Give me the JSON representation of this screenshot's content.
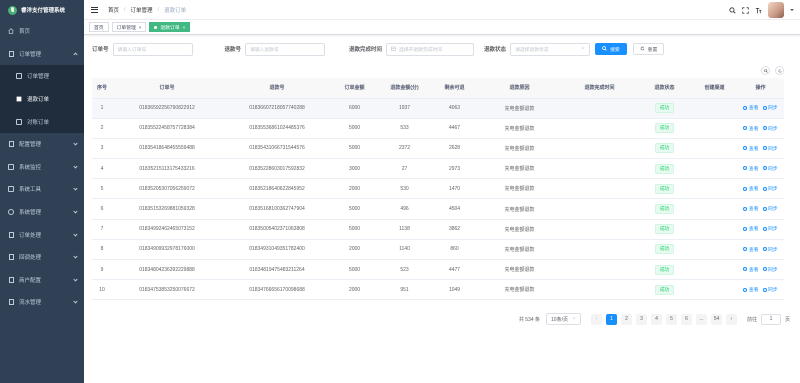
{
  "app": {
    "title": "睿洋支付管理系统"
  },
  "sidebar": {
    "items": [
      {
        "label": "首页",
        "icon": "home-icon"
      },
      {
        "label": "订单管理",
        "icon": "order-icon",
        "expanded": true,
        "children": [
          {
            "label": "订单管理",
            "active": false
          },
          {
            "label": "退款订单",
            "active": true
          },
          {
            "label": "对账订单",
            "active": false
          }
        ]
      },
      {
        "label": "配置管理",
        "icon": "config-icon"
      },
      {
        "label": "系统监控",
        "icon": "monitor-icon"
      },
      {
        "label": "系统工具",
        "icon": "tools-icon"
      },
      {
        "label": "系统管理",
        "icon": "settings-icon"
      },
      {
        "label": "订单处理",
        "icon": "process-icon"
      },
      {
        "label": "回调处理",
        "icon": "callback-icon"
      },
      {
        "label": "商户配置",
        "icon": "merchant-icon"
      },
      {
        "label": "流水管理",
        "icon": "flow-icon"
      }
    ]
  },
  "header": {
    "breadcrumb": [
      "首页",
      "订单管理",
      "退款订单"
    ]
  },
  "tags": [
    {
      "label": "首页",
      "active": false
    },
    {
      "label": "订单管理",
      "active": false
    },
    {
      "label": "退款订单",
      "active": true
    }
  ],
  "filters": {
    "order_no": {
      "label": "订单号",
      "placeholder": "请输入订单号"
    },
    "refund_no": {
      "label": "退款号",
      "placeholder": "请输入退款号"
    },
    "refund_time": {
      "label": "退款完成时间",
      "placeholder": "选择开退款完成时间"
    },
    "refund_status": {
      "label": "退款状态",
      "placeholder": "请选择退款状态"
    },
    "search_label": "搜索",
    "reset_label": "重置"
  },
  "table": {
    "columns": [
      "序号",
      "订单号",
      "退款号",
      "订单金额",
      "退款金额(分)",
      "剩余可退",
      "退款原因",
      "退款完成时间",
      "退款状态",
      "创建渠道",
      "操作"
    ],
    "view_label": "查看",
    "sync_label": "同步",
    "rows": [
      {
        "idx": "1",
        "order_no": "01836592256790822912",
        "refund_no": "01836607218057740288",
        "amount": "6000",
        "refund": "1937",
        "remain": "4063",
        "reason": "充电金额退款",
        "time": "",
        "status": "成功",
        "channel": ""
      },
      {
        "idx": "2",
        "order_no": "01835522458757728384",
        "refund_no": "01835536861024485376",
        "amount": "5000",
        "refund": "533",
        "remain": "4467",
        "reason": "充电金额退款",
        "time": "",
        "status": "成功",
        "channel": ""
      },
      {
        "idx": "3",
        "order_no": "01835418648455559488",
        "refund_no": "01835431066731544576",
        "amount": "5000",
        "refund": "2372",
        "remain": "2628",
        "reason": "充电金额退款",
        "time": "",
        "status": "成功",
        "channel": ""
      },
      {
        "idx": "4",
        "order_no": "01835215113175433216",
        "refund_no": "01835228603017592832",
        "amount": "3000",
        "refund": "27",
        "remain": "2973",
        "reason": "充电金额退款",
        "time": "",
        "status": "成功",
        "channel": ""
      },
      {
        "idx": "5",
        "order_no": "01835205307056259072",
        "refund_no": "01835218640622845952",
        "amount": "2000",
        "refund": "530",
        "remain": "1470",
        "reason": "充电金额退款",
        "time": "",
        "status": "成功",
        "channel": ""
      },
      {
        "idx": "6",
        "order_no": "01835153269881059328",
        "refund_no": "01835168100362747904",
        "amount": "5000",
        "refund": "496",
        "remain": "4504",
        "reason": "充电金额退款",
        "time": "",
        "status": "成功",
        "channel": ""
      },
      {
        "idx": "7",
        "order_no": "01834992462465073152",
        "refund_no": "01835005402371063808",
        "amount": "5000",
        "refund": "1138",
        "remain": "3862",
        "reason": "充电金额退款",
        "time": "",
        "status": "成功",
        "channel": ""
      },
      {
        "idx": "8",
        "order_no": "01834909932978176000",
        "refund_no": "01834931049351782400",
        "amount": "2000",
        "refund": "1140",
        "remain": "860",
        "reason": "充电金额退款",
        "time": "",
        "status": "成功",
        "channel": ""
      },
      {
        "idx": "9",
        "order_no": "01834804236392229888",
        "refund_no": "01834819475483211264",
        "amount": "5000",
        "refund": "523",
        "remain": "4477",
        "reason": "充电金额退款",
        "time": "",
        "status": "成功",
        "channel": ""
      },
      {
        "idx": "10",
        "order_no": "01834753853250076672",
        "refund_no": "01834766656170098688",
        "amount": "2000",
        "refund": "951",
        "remain": "1049",
        "reason": "充电金额退款",
        "time": "",
        "status": "成功",
        "channel": ""
      }
    ]
  },
  "pagination": {
    "total_text": "共 534 条",
    "page_size": "10条/页",
    "pages": [
      "1",
      "2",
      "3",
      "4",
      "5",
      "6",
      "...",
      "54"
    ],
    "current": "1",
    "goto_label": "前往",
    "goto_value": "1",
    "page_suffix": "页"
  },
  "colors": {
    "sidebar_bg": "#304156",
    "primary": "#1890ff",
    "tag_active": "#42b983",
    "success": "#13ce66"
  }
}
